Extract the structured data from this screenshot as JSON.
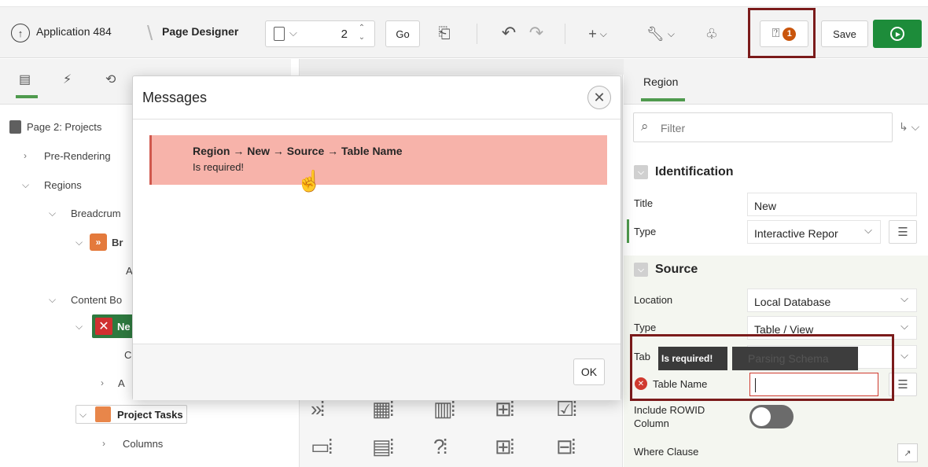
{
  "toolbar": {
    "app_label": "Application 484",
    "page_designer_label": "Page Designer",
    "page_number": "2",
    "go_label": "Go",
    "message_count": "1",
    "save_label": "Save"
  },
  "left_tree": {
    "page_title": "Page 2: Projects",
    "pre_rendering": "Pre-Rendering",
    "regions": "Regions",
    "breadcrumb_group": "Breadcrum",
    "breadcrumb_item": "Br",
    "breadcrumb_child": "A",
    "content_body": "Content Bo",
    "new_region": "Ne",
    "new_child_c": "C",
    "new_child_a": "A",
    "project_tasks": "Project Tasks",
    "columns": "Columns"
  },
  "dialog": {
    "title": "Messages",
    "message_path": "Region → New → Source → Table Name",
    "message_text": "Is required!",
    "ok_label": "OK"
  },
  "property_editor": {
    "tab_label": "Region",
    "filter_placeholder": "Filter",
    "identification": {
      "section_title": "Identification",
      "title_label": "Title",
      "title_value": "New",
      "type_label": "Type",
      "type_value": "Interactive Repor"
    },
    "source": {
      "section_title": "Source",
      "location_label": "Location",
      "location_value": "Local Database",
      "type_label": "Type",
      "type_value": "Table / View",
      "table_owner_label_partial": "Tab",
      "table_owner_value": "Parsing Schema",
      "table_name_label": "Table Name",
      "table_name_value": "",
      "rowid_label": "Include ROWID Column",
      "where_label": "Where Clause"
    },
    "tooltip_text": "Is required!"
  },
  "colors": {
    "accent_green": "#4f9a4e",
    "run_green": "#1d8c3a",
    "error_red": "#d03a2f",
    "highlight_box": "#7b1b1b",
    "message_bg": "#f7b3aa",
    "badge_orange": "#c9550c"
  }
}
